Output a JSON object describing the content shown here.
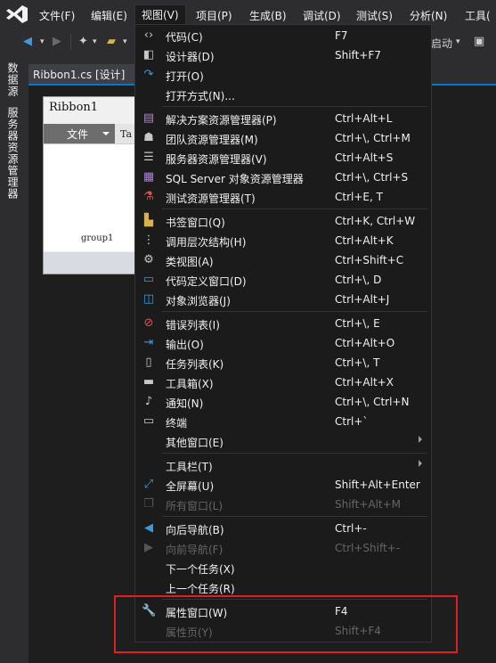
{
  "menubar": {
    "items": [
      "文件(F)",
      "编辑(E)",
      "视图(V)",
      "项目(P)",
      "生成(B)",
      "调试(D)",
      "测试(S)",
      "分析(N)",
      "工具("
    ]
  },
  "toolbar": {
    "start_label": "启动"
  },
  "sidetabs": {
    "tab1": "数据源",
    "tab2": "服务器资源管理器"
  },
  "doctab": {
    "title": "Ribbon1.cs [设计]"
  },
  "ribbon": {
    "title": "Ribbon1",
    "file_tab": "文件",
    "tab2_partial": "Ta",
    "group": "group1"
  },
  "menu": {
    "items": [
      {
        "icon": "code-icon",
        "label": "代码(C)",
        "shortcut": "F7"
      },
      {
        "icon": "designer-icon",
        "label": "设计器(D)",
        "shortcut": "Shift+F7"
      },
      {
        "icon": "open-icon",
        "label": "打开(O)",
        "shortcut": ""
      },
      {
        "icon": "",
        "label": "打开方式(N)...",
        "shortcut": ""
      },
      {
        "icon": "solution-explorer-icon",
        "label": "解决方案资源管理器(P)",
        "shortcut": "Ctrl+Alt+L"
      },
      {
        "icon": "team-explorer-icon",
        "label": "团队资源管理器(M)",
        "shortcut": "Ctrl+\\, Ctrl+M"
      },
      {
        "icon": "server-explorer-icon",
        "label": "服务器资源管理器(V)",
        "shortcut": "Ctrl+Alt+S"
      },
      {
        "icon": "sql-server-icon",
        "label": "SQL Server 对象资源管理器",
        "shortcut": "Ctrl+\\, Ctrl+S"
      },
      {
        "icon": "test-explorer-icon",
        "label": "测试资源管理器(T)",
        "shortcut": "Ctrl+E, T"
      },
      {
        "icon": "bookmark-icon",
        "label": "书签窗口(Q)",
        "shortcut": "Ctrl+K, Ctrl+W"
      },
      {
        "icon": "call-hierarchy-icon",
        "label": "调用层次结构(H)",
        "shortcut": "Ctrl+Alt+K"
      },
      {
        "icon": "class-view-icon",
        "label": "类视图(A)",
        "shortcut": "Ctrl+Shift+C"
      },
      {
        "icon": "code-definition-icon",
        "label": "代码定义窗口(D)",
        "shortcut": "Ctrl+\\, D"
      },
      {
        "icon": "object-browser-icon",
        "label": "对象浏览器(J)",
        "shortcut": "Ctrl+Alt+J"
      },
      {
        "icon": "error-list-icon",
        "label": "错误列表(I)",
        "shortcut": "Ctrl+\\, E"
      },
      {
        "icon": "output-icon",
        "label": "输出(O)",
        "shortcut": "Ctrl+Alt+O"
      },
      {
        "icon": "task-list-icon",
        "label": "任务列表(K)",
        "shortcut": "Ctrl+\\, T"
      },
      {
        "icon": "toolbox-icon",
        "label": "工具箱(X)",
        "shortcut": "Ctrl+Alt+X"
      },
      {
        "icon": "bell-icon",
        "label": "通知(N)",
        "shortcut": "Ctrl+\\, Ctrl+N"
      },
      {
        "icon": "terminal-icon",
        "label": "终端",
        "shortcut": "Ctrl+`"
      },
      {
        "icon": "",
        "label": "其他窗口(E)",
        "shortcut": ""
      },
      {
        "icon": "",
        "label": "工具栏(T)",
        "shortcut": ""
      },
      {
        "icon": "fullscreen-icon",
        "label": "全屏幕(U)",
        "shortcut": "Shift+Alt+Enter"
      },
      {
        "icon": "all-windows-icon",
        "label": "所有窗口(L)",
        "shortcut": "Shift+Alt+M"
      },
      {
        "icon": "navigate-back-icon",
        "label": "向后导航(B)",
        "shortcut": "Ctrl+-"
      },
      {
        "icon": "navigate-forward-icon",
        "label": "向前导航(F)",
        "shortcut": "Ctrl+Shift+-"
      },
      {
        "icon": "",
        "label": "下一个任务(X)",
        "shortcut": ""
      },
      {
        "icon": "",
        "label": "上一个任务(R)",
        "shortcut": ""
      },
      {
        "icon": "wrench-icon",
        "label": "属性窗口(W)",
        "shortcut": "F4"
      },
      {
        "icon": "property-pages-icon",
        "label": "属性页(Y)",
        "shortcut": "Shift+F4"
      }
    ]
  }
}
